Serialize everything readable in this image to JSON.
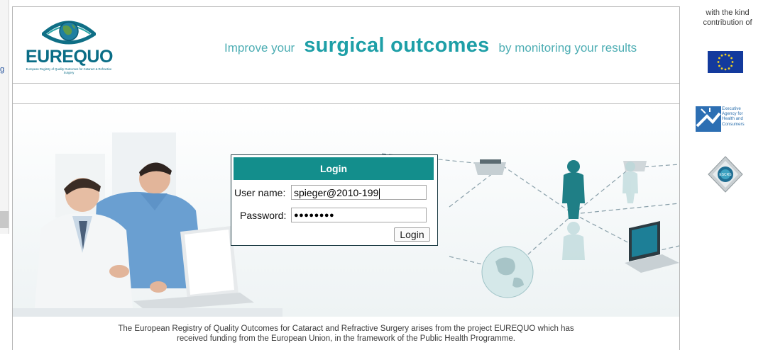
{
  "header": {
    "logo_text": "EUREQUO",
    "logo_subtext": "European Registry of Quality Outcomes for Cataract & Refractive Surgery",
    "tagline_pre": "Improve your",
    "tagline_main": "surgical outcomes",
    "tagline_post": "by monitoring your results"
  },
  "login": {
    "title": "Login",
    "username_label": "User name:",
    "username_value": "spieger@2010-199",
    "password_label": "Password:",
    "password_value": "●●●●●●●●",
    "button_label": "Login"
  },
  "footer": {
    "line1": "The European Registry of Quality Outcomes for Cataract and Refractive Surgery arises from the project EUREQUO which has",
    "line2": "received funding from the European Union, in the framework of the Public Health Programme."
  },
  "sidebar": {
    "contribution_text": "with the kind contribution of",
    "eahc_label": "Executive Agency for Health and Consumers",
    "escrs_label": "ESCRS"
  },
  "left_edge_char": "g",
  "colors": {
    "brand": "#0a6d86",
    "accent": "#138e8c",
    "tagline": "#4cadb3"
  }
}
